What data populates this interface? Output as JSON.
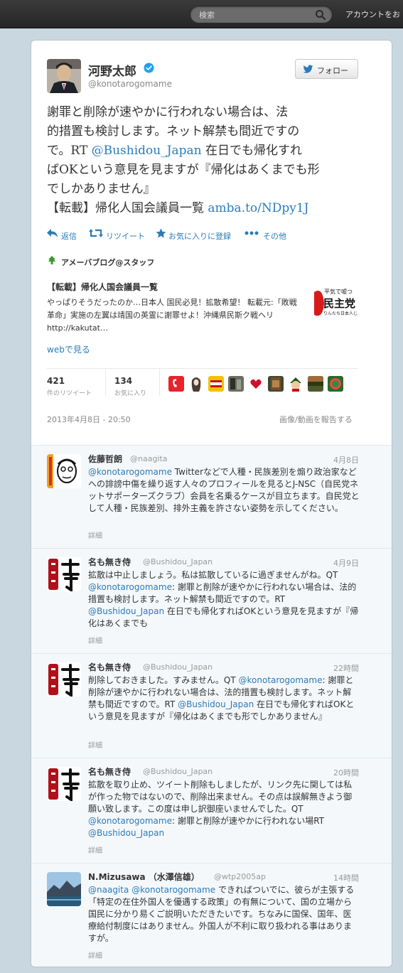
{
  "topbar": {
    "search_placeholder": "検索",
    "account_link": "アカウントをお"
  },
  "tweet": {
    "author_name": "河野太郎",
    "author_handle": "@konotarogomame",
    "follow_label": "フォロー",
    "text_line1": "謝罪と削除が速やかに行われない場合は、法",
    "text_line2": "的措置も検討します。ネット解禁も間近ですの",
    "text_line3a": "で。RT ",
    "text_line3_link": "@Bushidou_Japan",
    "text_line3b": " 在日でも帰化すれ",
    "text_line4": "ばOKという意見を見ますが『帰化はあくまでも形",
    "text_line5": "でしかありません』",
    "text_line6a": "【転載】帰化人国会議員一覧 ",
    "text_line6_link": "amba.to/NDpy1J",
    "actions": {
      "reply": "返信",
      "retweet": "リツイート",
      "favorite": "お気に入りに登録",
      "more": "その他"
    },
    "source": "アメーバブログ@スタッフ",
    "card_title": "【転載】帰化人国会議員一覧",
    "card_desc": "やっぱりそうだったのか…日本人 国民必見！拡散希望！ 転載元:「敗戦革命」実施の左翼は靖国の英霊に謝罪せよ！沖縄県民斯ク戦ヘリhttp://kakutat…",
    "web_link": "webで見る",
    "retweet_count": "421",
    "retweet_label": "件のリツイート",
    "fav_count": "134",
    "fav_label": "お気に入り",
    "timestamp": "2013年4月8日 - 20:50",
    "report_link": "画像/動画を報告する",
    "thumb_text_top": "平気で嘘つ",
    "thumb_text_main": "民主党",
    "thumb_text_bottom": "りんたち日本人じゃない"
  },
  "replies": [
    {
      "name": "佐藤哲朗",
      "handle": "@naagita",
      "time": "4月8日",
      "segments": [
        {
          "t": "@konotarogomame",
          "link": true
        },
        {
          "t": " Twitterなどで人種・民族差別を煽り政治家などへの誹謗中傷を繰り返す人々のプロフィールを見るとJ-NSC（自民党ネットサポーターズクラブ）会員を名乗るケースが目立ちます。自民党として人種・民族差別、排外主義を許さない姿勢を示してください。",
          "link": false
        }
      ],
      "detail": "詳細"
    },
    {
      "name": "名も無き侍",
      "handle": "@Bushidou_Japan",
      "time": "4月9日",
      "segments": [
        {
          "t": "拡散は中止しましょう。私は拡散しているに過ぎませんがね。QT ",
          "link": false
        },
        {
          "t": "@konotarogomame",
          "link": true
        },
        {
          "t": ": 謝罪と削除が速やかに行われない場合は、法的措置も検討します。ネット解禁も間近ですので。RT ",
          "link": false
        },
        {
          "t": "@Bushidou_Japan",
          "link": true
        },
        {
          "t": " 在日でも帰化すればOKという意見を見ますが『帰化はあくまでも",
          "link": false
        }
      ],
      "detail": "詳細"
    },
    {
      "name": "名も無き侍",
      "handle": "@Bushidou_Japan",
      "time": "22時間",
      "segments": [
        {
          "t": "削除しておきました。すみません。QT ",
          "link": false
        },
        {
          "t": "@konotarogomame",
          "link": true
        },
        {
          "t": ": 謝罪と削除が速やかに行われない場合は、法的措置も検討します。ネット解禁も間近ですので。RT ",
          "link": false
        },
        {
          "t": "@Bushidou_Japan",
          "link": true
        },
        {
          "t": " 在日でも帰化すればOKという意見を見ますが『帰化はあくまでも形でしかありません』",
          "link": false
        }
      ],
      "detail": "詳細"
    },
    {
      "name": "名も無き侍",
      "handle": "@Bushidou_Japan",
      "time": "20時間",
      "segments": [
        {
          "t": "拡散を取り止め、ツイート削除もしましたが、リンク先に関しては私が作った物ではないので、削除出来ません。その点は誤解無きよう御願い致します。この度は申し訳御座いませんでした。QT ",
          "link": false
        },
        {
          "t": "@konotarogomame",
          "link": true
        },
        {
          "t": ": 謝罪と削除が速やかに行われない場RT ",
          "link": false
        },
        {
          "t": "@Bushidou_Japan",
          "link": true
        }
      ],
      "detail": "詳細"
    },
    {
      "name": "N.Mizusawa （水澤信雄）",
      "handle": "@wtp2005ap",
      "time": "14時間",
      "segments": [
        {
          "t": "@naagita",
          "link": true
        },
        {
          "t": " ",
          "link": false
        },
        {
          "t": "@konotarogomame",
          "link": true
        },
        {
          "t": " できればついでに、彼らが主張する「特定の在住外国人を優遇する政策」の有無について、国の立場から国民に分かり易くご説明いただきたいです。ちなみに国保、国年、医療給付制度にはありません。外国人が不利に取り扱われる事はありますが。",
          "link": false
        }
      ],
      "detail": "詳細"
    }
  ],
  "colors": {
    "link": "#2b7bb9",
    "background": "#c9d7e1",
    "topbar": "#2e2e2e",
    "verified": "#1da1f2"
  }
}
